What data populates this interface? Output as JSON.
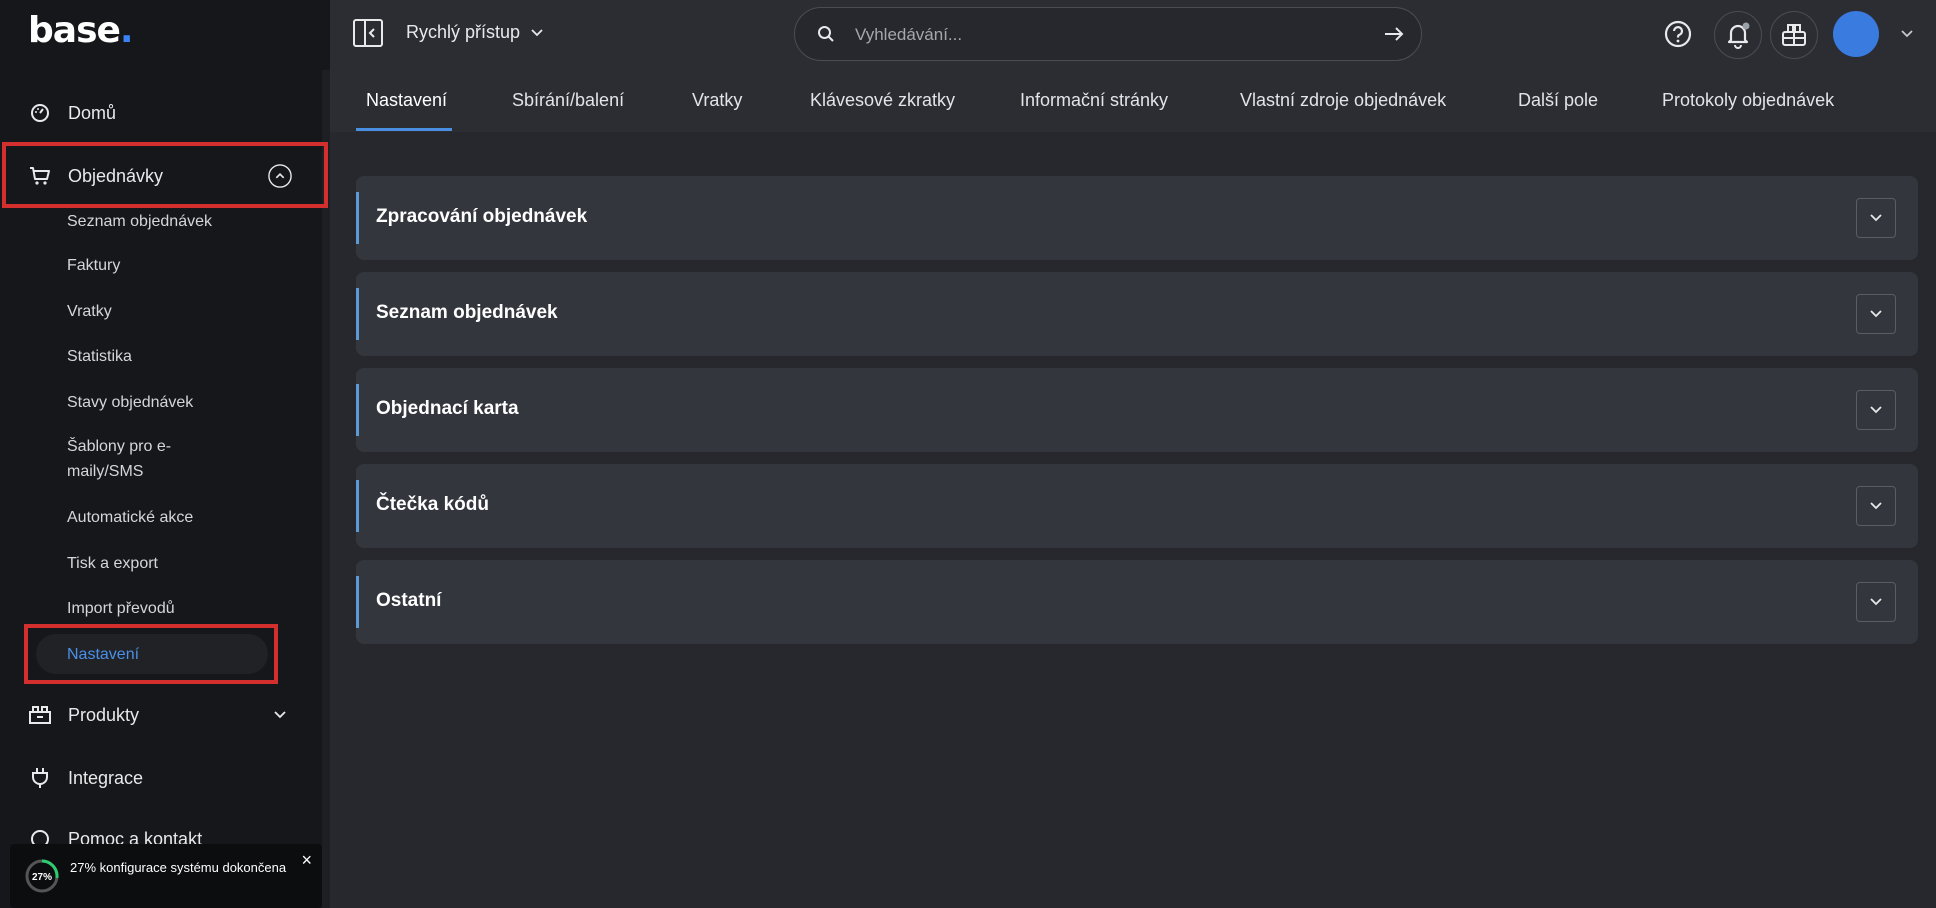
{
  "brand": {
    "logo_text": "base",
    "logo_dot": "."
  },
  "sidebar": {
    "items": [
      {
        "id": "home",
        "label": "Domů",
        "icon": "gauge-icon"
      },
      {
        "id": "orders",
        "label": "Objednávky",
        "icon": "cart-icon",
        "expanded": true
      },
      {
        "id": "products",
        "label": "Produkty",
        "icon": "boxes-icon"
      },
      {
        "id": "integrations",
        "label": "Integrace",
        "icon": "plug-icon"
      },
      {
        "id": "help",
        "label": "Pomoc a kontakt",
        "icon": "help-circle-icon"
      }
    ],
    "orders_submenu": [
      "Seznam objednávek",
      "Faktury",
      "Vratky",
      "Statistika",
      "Stavy objednávek",
      "Šablony pro e-",
      "maily/SMS",
      "Automatické akce",
      "Tisk a export",
      "Import převodů",
      "Nastavení"
    ],
    "active_submenu": "Nastavení"
  },
  "toast": {
    "percent_label": "27%",
    "progress": 0.27,
    "text": "27% konfigurace systému dokončena",
    "close": "×"
  },
  "topbar": {
    "quick_access": "Rychlý přístup",
    "search_placeholder": "Vyhledávání...",
    "icons": [
      "help-icon",
      "bell-icon",
      "apps-icon",
      "avatar"
    ]
  },
  "tabs": [
    "Nastavení",
    "Sbírání/balení",
    "Vratky",
    "Klávesové zkratky",
    "Informační stránky",
    "Vlastní zdroje objednávek",
    "Další pole",
    "Protokoly objednávek"
  ],
  "active_tab": "Nastavení",
  "panels": [
    "Zpracování objednávek",
    "Seznam objednávek",
    "Objednací karta",
    "Čtečka kódů",
    "Ostatní"
  ],
  "colors": {
    "accent": "#4a90e2",
    "highlight": "#d32f2f",
    "avatar": "#3a7be0",
    "active_submenu_text": "#4a8fe8"
  }
}
